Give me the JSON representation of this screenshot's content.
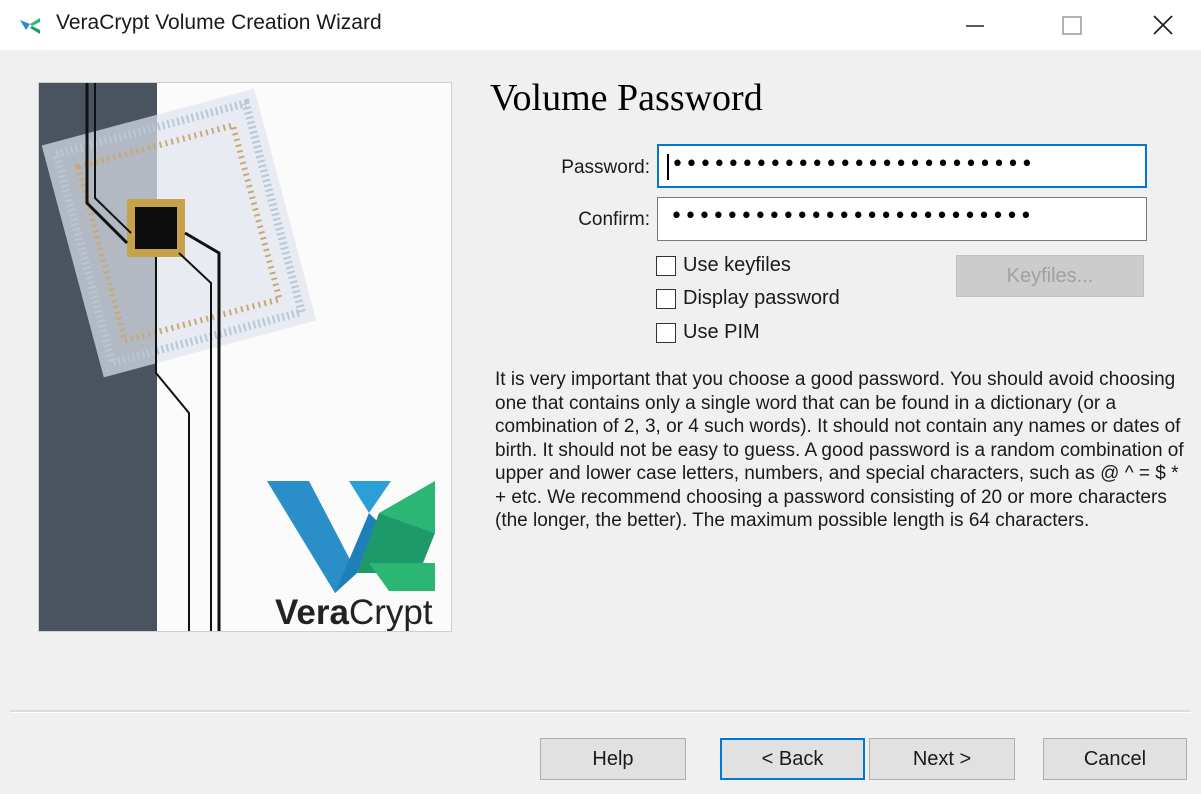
{
  "window": {
    "title": "VeraCrypt Volume Creation Wizard",
    "controls": [
      "minimize",
      "maximize",
      "close"
    ]
  },
  "sidebar_image": {
    "brand_bold": "Vera",
    "brand_regular": "Crypt",
    "colors": {
      "dark_band": "#4a5360",
      "chip_gold": "#c8a24a",
      "logo_blue": "#2a8fc9",
      "logo_green": "#2bb673"
    }
  },
  "page": {
    "heading": "Volume Password",
    "password_label": "Password:",
    "password_value": "••••••••••••••••••••••••••",
    "confirm_label": "Confirm:",
    "confirm_value": "••••••••••••••••••••••••••",
    "checkboxes": [
      {
        "label": "Use keyfiles",
        "checked": false
      },
      {
        "label": "Display password",
        "checked": false
      },
      {
        "label": "Use PIM",
        "checked": false
      }
    ],
    "keyfiles_button": "Keyfiles...",
    "info_text": "It is very important that you choose a good password. You should avoid choosing one that contains only a single word that can be found in a dictionary (or a combination of 2, 3, or 4 such words). It should not contain any names or dates of birth. It should not be easy to guess. A good password is a random combination of upper and lower case letters, numbers, and special characters, such as @ ^ = $ * + etc. We recommend choosing a password consisting of 20 or more characters (the longer, the better). The maximum possible length is 64 characters."
  },
  "footer": {
    "help": "Help",
    "back": "< Back",
    "next": "Next >",
    "cancel": "Cancel"
  },
  "colors": {
    "accent": "#0078d7",
    "background": "#f0f0f0"
  }
}
